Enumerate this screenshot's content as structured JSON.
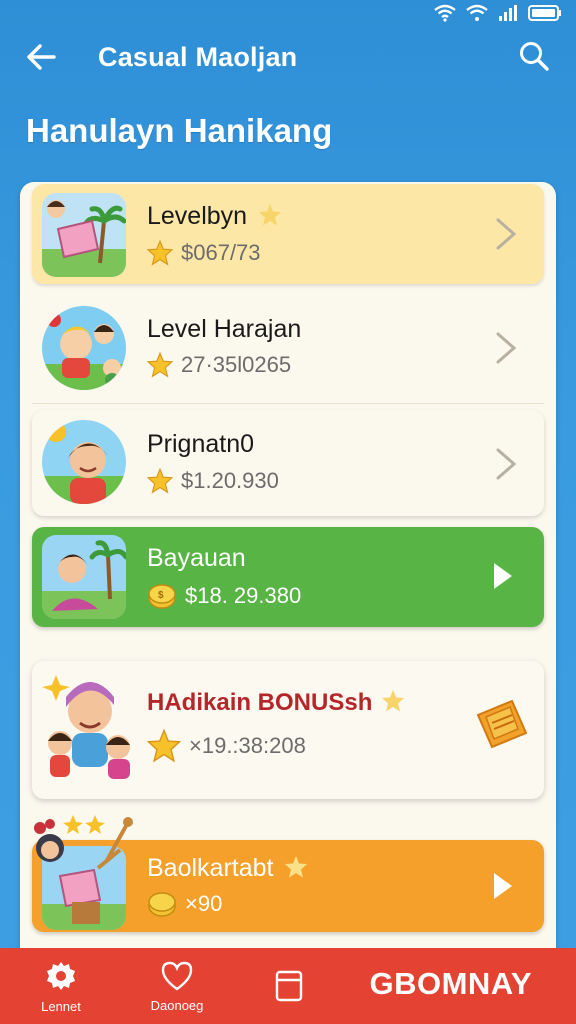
{
  "app_bar": {
    "title": "Casual Maoljan"
  },
  "section": {
    "title": "Hanulayn Hanikang"
  },
  "items": [
    {
      "title": "Levelbyn",
      "value": "$067/73"
    },
    {
      "title": "Level Harajan",
      "value": "27·35l0265"
    },
    {
      "title": "Prignatn0",
      "value": "$1.20.930"
    },
    {
      "title": "Bayauan",
      "value": "$18. 29.380"
    },
    {
      "title": "HAdikain BONUSsh",
      "value": "×19.:38:208"
    },
    {
      "title": "Baolkartabt",
      "value": "×90"
    }
  ],
  "bottom_nav": {
    "items": [
      {
        "label": "Lennet"
      },
      {
        "label": "Daonoeg"
      },
      {
        "label": ""
      }
    ],
    "brand": "GBOMNAY"
  },
  "colors": {
    "header_blue": "#2f8fd6",
    "highlight_yellow": "#fde7a6",
    "green": "#58b444",
    "orange": "#f5a02a",
    "nav_red": "#e44232",
    "bonus_red": "#b5262a",
    "star": "#f7c12a"
  },
  "icons": {
    "back": "arrow-left-icon",
    "search": "search-icon",
    "star": "star-icon",
    "chevron": "chevron-right-icon",
    "play": "play-icon",
    "coin": "coin-icon",
    "bonus_badge": "ticket-badge-icon",
    "nav_settings": "gear-icon",
    "nav_heart": "heart-icon",
    "nav_box": "box-icon"
  }
}
